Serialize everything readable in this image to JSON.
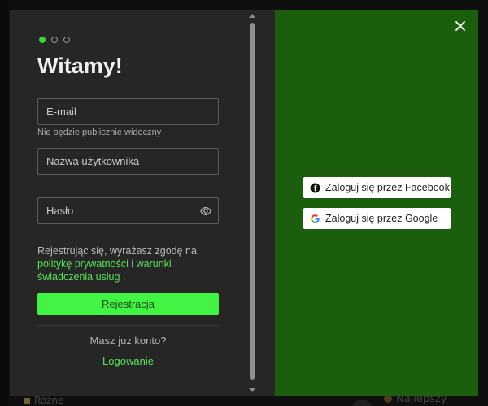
{
  "modal": {
    "title": "Witamy!",
    "steps": [
      {
        "active": true
      },
      {
        "active": false
      },
      {
        "active": false
      }
    ],
    "email": {
      "placeholder": "E-mail",
      "hint": "Nie będzie publicznie widoczny"
    },
    "username": {
      "placeholder": "Nazwa użytkownika"
    },
    "password": {
      "placeholder": "Hasło",
      "toggle_icon": "eye-icon"
    },
    "terms": {
      "prefix": "Rejestrując się, wyrażasz zgodę na",
      "privacy_link": "politykę prywatności",
      "conjunction": "i",
      "terms_link": "warunki świadczenia usług",
      "suffix": "."
    },
    "register_label": "Rejestracja",
    "have_account": "Masz już konto?",
    "login_label": "Logowanie",
    "close_icon": "close-icon",
    "social": {
      "facebook_label": "Zaloguj się przez Facebook",
      "google_label": "Zaloguj się przez Google"
    }
  },
  "background": {
    "footer_category": "Różne",
    "footer_item": "Najlepszy amplitun"
  },
  "colors": {
    "accent": "#42f542",
    "link": "#56e356",
    "right_panel": "#1b5e0e",
    "left_panel": "#262626"
  }
}
